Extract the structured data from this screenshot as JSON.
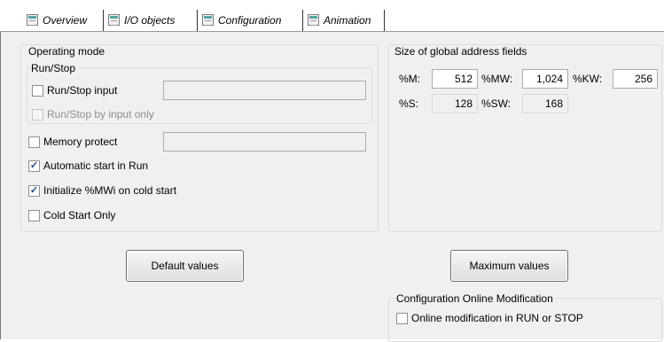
{
  "tabs": [
    {
      "label": "Overview",
      "icon": "module-icon",
      "active": false
    },
    {
      "label": "I/O objects",
      "icon": "module-icon",
      "active": false
    },
    {
      "label": "Configuration",
      "icon": "module-icon",
      "active": true
    },
    {
      "label": "Animation",
      "icon": "module-icon",
      "active": false
    }
  ],
  "operating_mode": {
    "title": "Operating mode",
    "run_stop_group": {
      "title": "Run/Stop",
      "run_stop_input": {
        "label": "Run/Stop input",
        "checked": false
      },
      "run_stop_by_input_only": {
        "label": "Run/Stop by input only",
        "checked": false,
        "enabled": false
      }
    },
    "memory_protect": {
      "label": "Memory protect",
      "checked": false
    },
    "automatic_start": {
      "label": "Automatic start in Run",
      "checked": true
    },
    "initialize_mwi": {
      "label": "Initialize %MWi on cold start",
      "checked": true
    },
    "cold_start_only": {
      "label": "Cold Start Only",
      "checked": false
    }
  },
  "address_fields": {
    "title": "Size of global address fields",
    "m": {
      "label": "%M:",
      "value": "512"
    },
    "mw": {
      "label": "%MW:",
      "value": "1,024"
    },
    "kw": {
      "label": "%KW:",
      "value": "256"
    },
    "s": {
      "label": "%S:",
      "value": "128"
    },
    "sw": {
      "label": "%SW:",
      "value": "168"
    }
  },
  "buttons": {
    "default_values": "Default values",
    "maximum_values": "Maximum values"
  },
  "online_modification": {
    "title": "Configuration Online Modification",
    "option": {
      "label": "Online modification in RUN or STOP",
      "checked": false
    }
  },
  "check_mark": "✓"
}
